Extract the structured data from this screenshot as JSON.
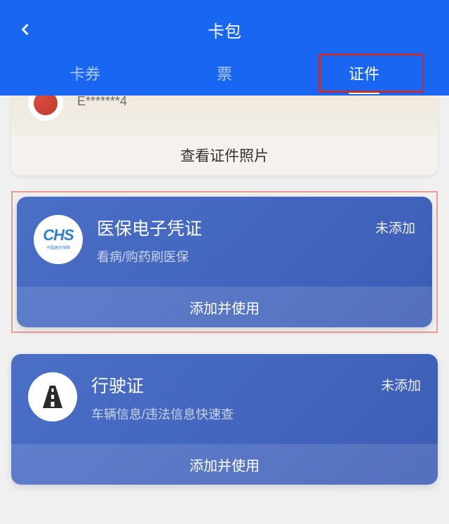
{
  "header": {
    "title": "卡包"
  },
  "tabs": [
    {
      "label": "卡券"
    },
    {
      "label": "票"
    },
    {
      "label": "证件"
    }
  ],
  "existing_card": {
    "masked_id": "E*******4",
    "action": "查看证件照片"
  },
  "cards": [
    {
      "icon_logo": "CHS",
      "icon_subtitle": "中国医疗保障",
      "title": "医保电子凭证",
      "subtitle": "看病/购药刷医保",
      "status": "未添加",
      "action": "添加并使用"
    },
    {
      "title": "行驶证",
      "subtitle": "车辆信息/违法信息快速查",
      "status": "未添加",
      "action": "添加并使用"
    }
  ]
}
